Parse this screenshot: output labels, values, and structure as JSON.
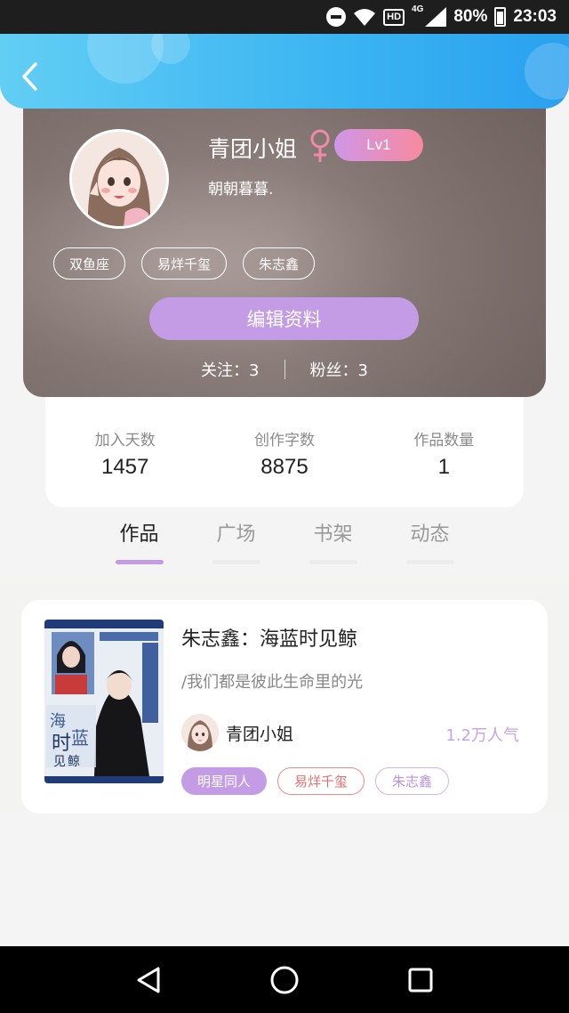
{
  "status_bar": {
    "network": "4G",
    "hd": "HD",
    "battery": "80%",
    "time": "23:03"
  },
  "header": {
    "back_icon": "chevron-left-icon",
    "gradient_colors": [
      "#62cef4",
      "#2aa0ef"
    ]
  },
  "profile": {
    "username": "青团小姐",
    "gender_icon": "female-icon",
    "level": "Lv1",
    "signature": "朝朝暮暮.",
    "tags": [
      "双鱼座",
      "易烊千玺",
      "朱志鑫"
    ],
    "edit_label": "编辑资料",
    "following_label": "关注：3",
    "followers_label": "粉丝：3"
  },
  "stats": [
    {
      "label": "加入天数",
      "value": "1457"
    },
    {
      "label": "创作字数",
      "value": "8875"
    },
    {
      "label": "作品数量",
      "value": "1"
    }
  ],
  "tabs": [
    {
      "label": "作品",
      "active": true
    },
    {
      "label": "广场",
      "active": false
    },
    {
      "label": "书架",
      "active": false
    },
    {
      "label": "动态",
      "active": false
    }
  ],
  "work": {
    "title": "朱志鑫：海蓝时见鲸",
    "description": "/我们都是彼此生命里的光",
    "author": "青团小姐",
    "popularity": "1.2万人气",
    "tags": [
      "明星同人",
      "易烊千玺",
      "朱志鑫"
    ],
    "cover_text": [
      "海",
      "时",
      "蓝",
      "见",
      "鲸"
    ]
  },
  "navbar": {
    "buttons": [
      "back-triangle-icon",
      "home-circle-icon",
      "recents-square-icon"
    ]
  },
  "colors": {
    "accent_purple": "#c49ce6",
    "header_blue": "#3bb4f2",
    "tag_red": "#ec8a8a"
  }
}
